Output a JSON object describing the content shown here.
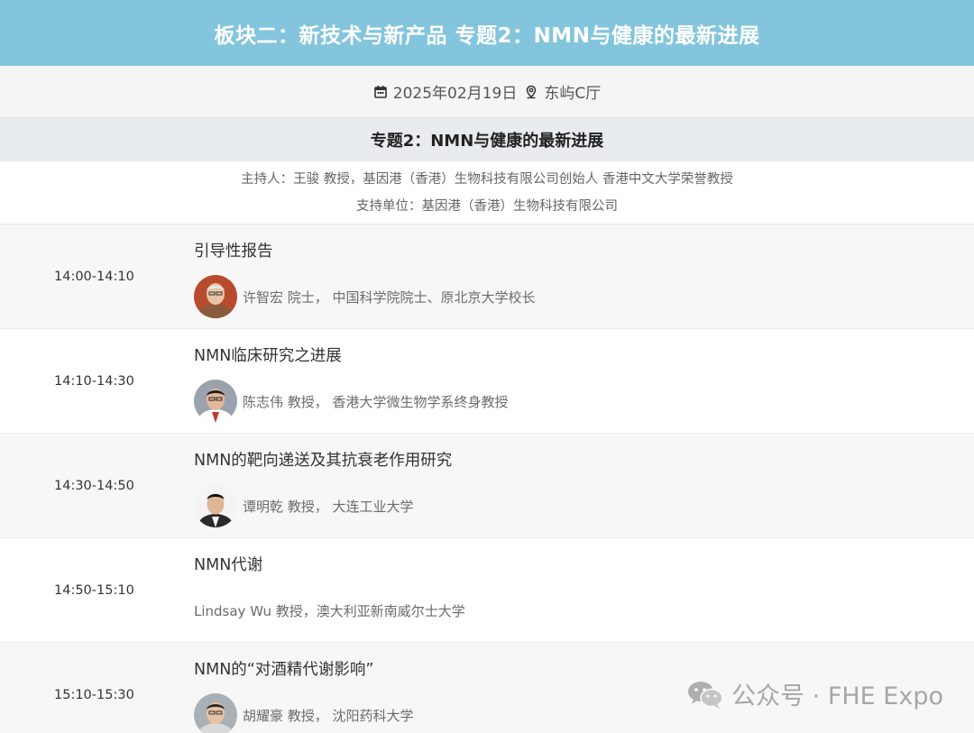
{
  "banner": {
    "title": "板块二：新技术与新产品 专题2：NMN与健康的最新进展"
  },
  "meta": {
    "date": "2025年02月19日",
    "location": "东屿C厅"
  },
  "topic": {
    "title": "专题2：NMN与健康的最新进展"
  },
  "host": {
    "line1": "主持人：王骏 教授，基因港（香港）生物科技有限公司创始人 香港中文大学荣誉教授",
    "line2": "支持单位：基因港（香港）生物科技有限公司"
  },
  "sessions": [
    {
      "time": "14:00-14:10",
      "title": "引导性报告",
      "speaker": "许智宏 院士， 中国科学院院士、原北京大学校长"
    },
    {
      "time": "14:10-14:30",
      "title": "NMN临床研究之进展",
      "speaker": "陈志伟 教授， 香港大学微生物学系终身教授"
    },
    {
      "time": "14:30-14:50",
      "title": "NMN的靶向递送及其抗衰老作用研究",
      "speaker": "谭明乾 教授， 大连工业大学"
    },
    {
      "time": "14:50-15:10",
      "title": "NMN代谢",
      "speaker": "Lindsay Wu 教授，澳大利亚新南威尔士大学"
    },
    {
      "time": "15:10-15:30",
      "title": "NMN的“对酒精代谢影响”",
      "speaker": "胡耀豪 教授， 沈阳药科大学"
    }
  ],
  "watermark": {
    "text": "公众号 · FHE Expo",
    "icon": "wechat-icon"
  },
  "icons": {
    "date": "calendar-icon",
    "location": "location-pin-icon"
  },
  "colors": {
    "banner": "#83c5dc",
    "topic_bar": "#e9ecef",
    "row_shade": "#f7f7f7"
  }
}
